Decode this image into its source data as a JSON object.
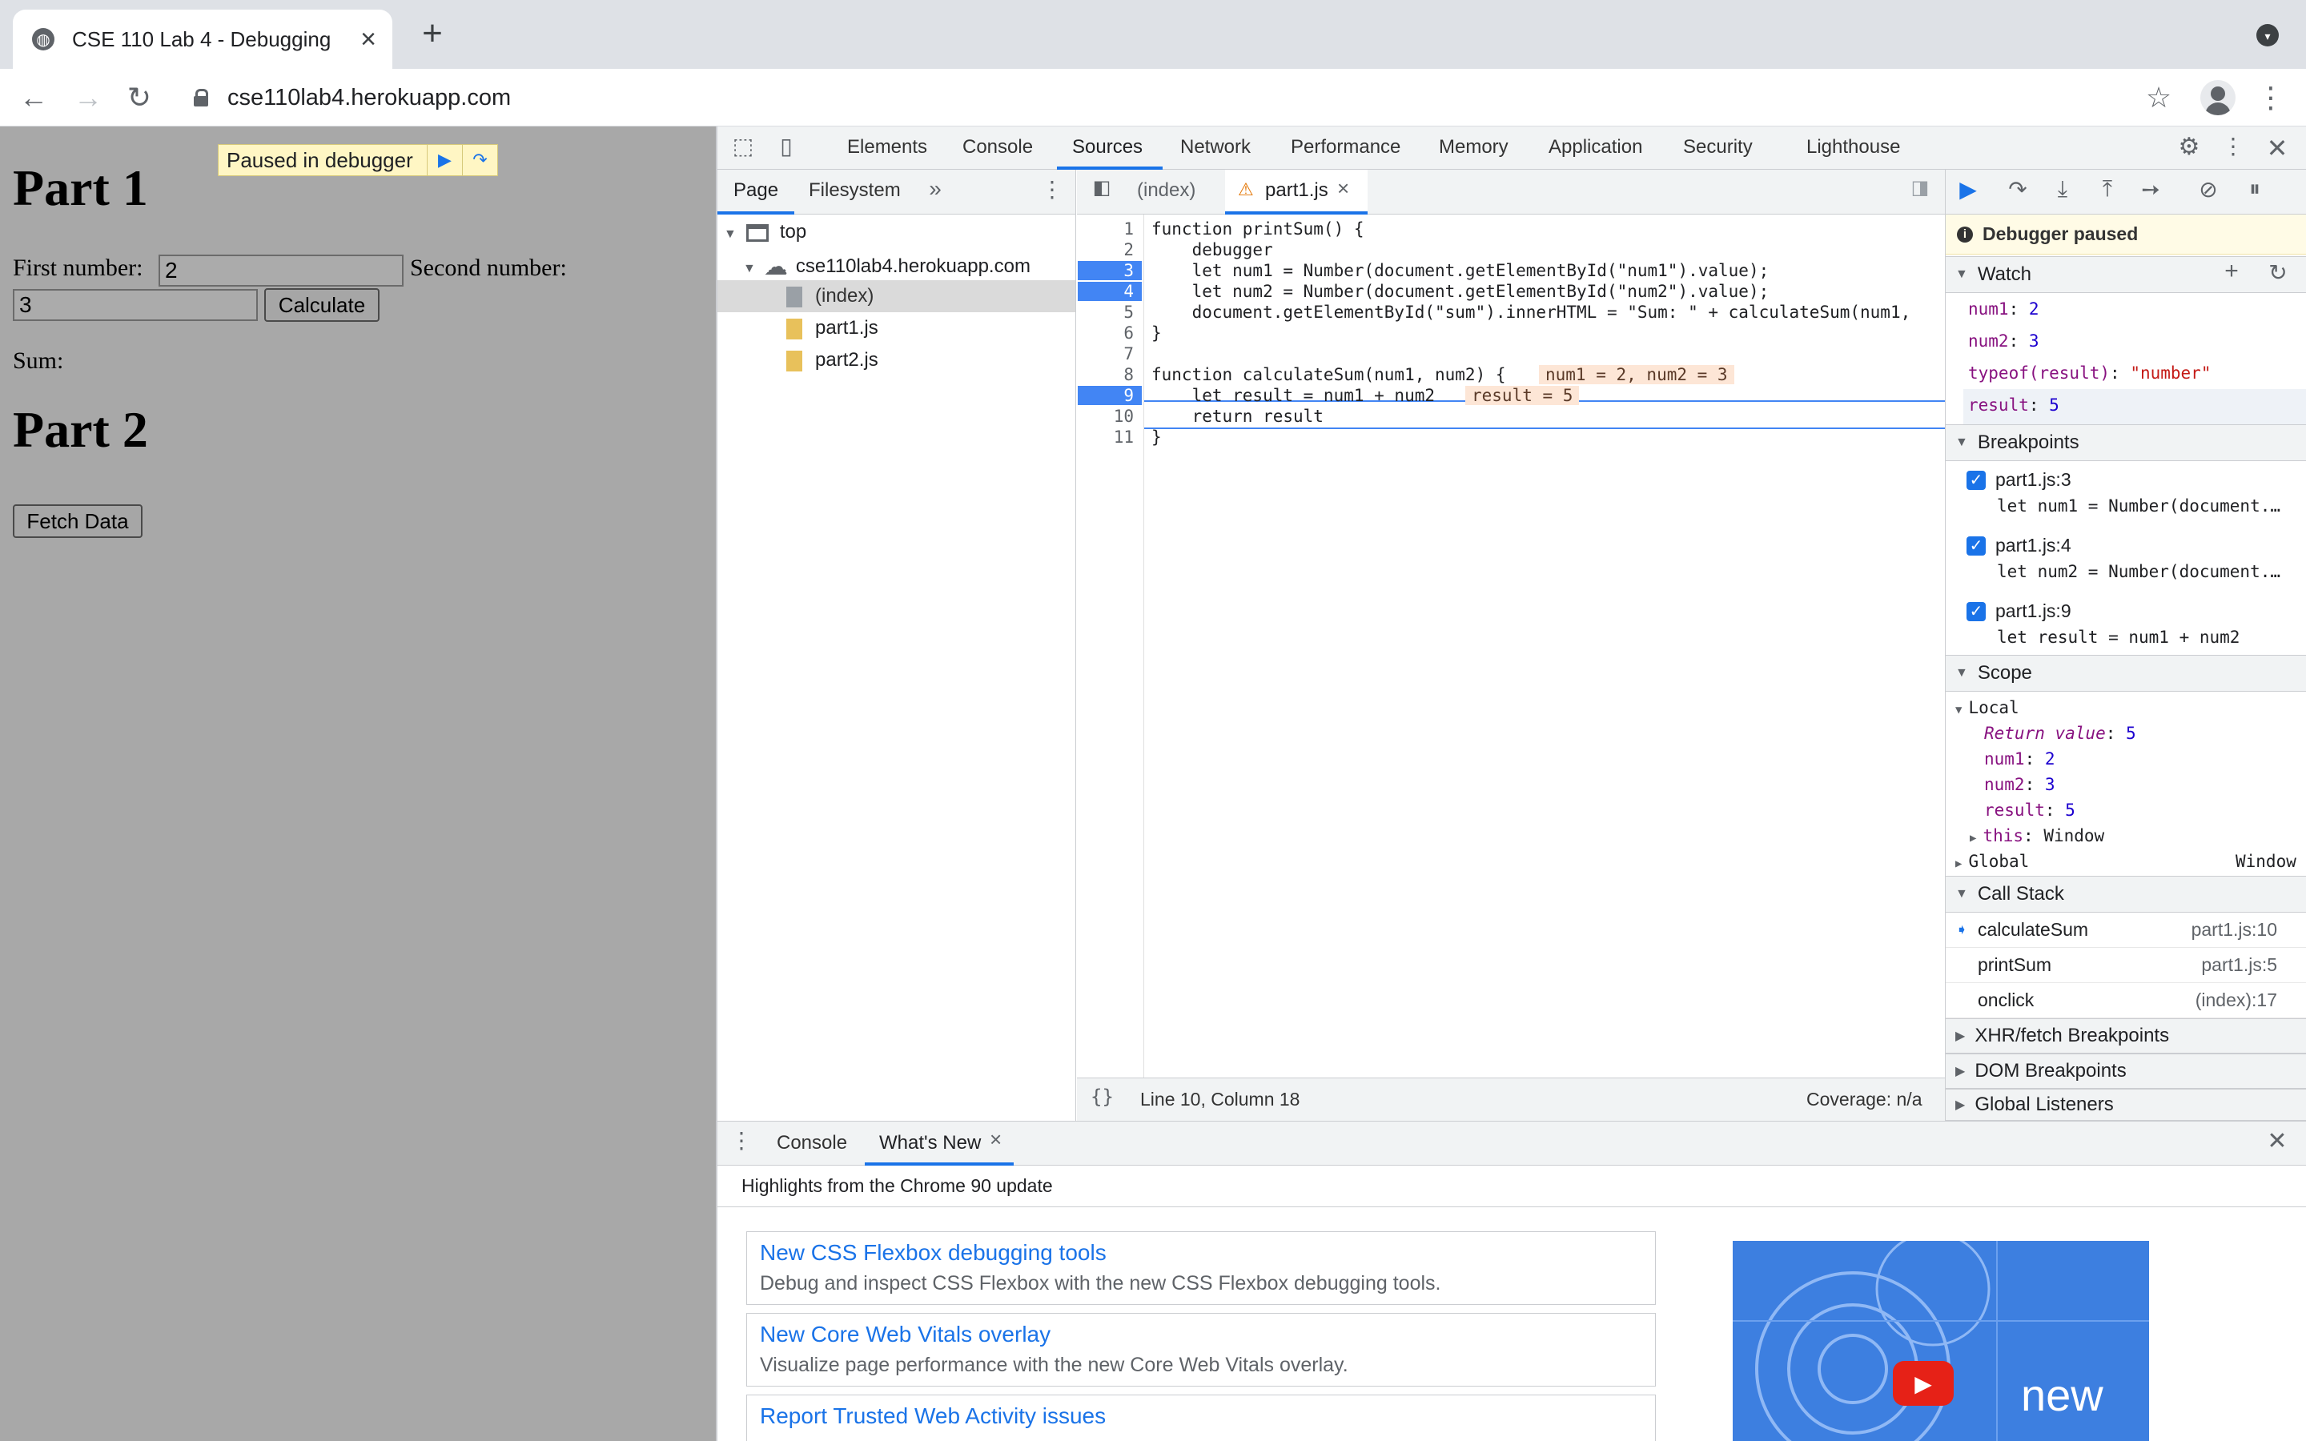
{
  "browser": {
    "tab_title": "CSE 110 Lab 4 - Debugging",
    "url": "cse110lab4.herokuapp.com"
  },
  "page": {
    "part1_heading": "Part 1",
    "first_number_label": "First number:",
    "first_number_value": "2",
    "second_number_label": "Second number:",
    "second_number_value": "3",
    "calculate_label": "Calculate",
    "sum_label": "Sum:",
    "part2_heading": "Part 2",
    "fetch_label": "Fetch Data",
    "paused_text": "Paused in debugger"
  },
  "devtools": {
    "tabs": [
      "Elements",
      "Console",
      "Sources",
      "Network",
      "Performance",
      "Memory",
      "Application",
      "Security",
      "Lighthouse"
    ],
    "active_tab": "Sources",
    "navigator_tabs": [
      "Page",
      "Filesystem"
    ],
    "tree": {
      "top": "top",
      "domain": "cse110lab4.herokuapp.com",
      "files": [
        "(index)",
        "part1.js",
        "part2.js"
      ]
    },
    "editor_tabs": [
      "(index)",
      "part1.js"
    ],
    "code_lines": [
      "function printSum() {",
      "    debugger",
      "    let num1 = Number(document.getElementById(\"num1\").value);",
      "    let num2 = Number(document.getElementById(\"num2\").value);",
      "    document.getElementById(\"sum\").innerHTML = \"Sum: \" + calculateSum(num1,",
      "}",
      "",
      "function calculateSum(num1, num2) {",
      "    let result = num1 + num2",
      "    return result",
      "}"
    ],
    "line_numbers": [
      "1",
      "2",
      "3",
      "4",
      "5",
      "6",
      "7",
      "8",
      "9",
      "10",
      "11"
    ],
    "inline_values": {
      "line8": "num1 = 2, num2 = 3",
      "line9": "result = 5"
    },
    "status": {
      "position": "Line 10, Column 18",
      "coverage": "Coverage: n/a"
    },
    "debugger_paused": "Debugger paused",
    "watch": {
      "title": "Watch",
      "items": [
        {
          "name": "num1",
          "value": "2"
        },
        {
          "name": "num2",
          "value": "3"
        },
        {
          "name": "typeof(result)",
          "value": "\"number\""
        },
        {
          "name": "result",
          "value": "5"
        }
      ]
    },
    "breakpoints": {
      "title": "Breakpoints",
      "items": [
        {
          "loc": "part1.js:3",
          "code": "let num1 = Number(document.…"
        },
        {
          "loc": "part1.js:4",
          "code": "let num2 = Number(document.…"
        },
        {
          "loc": "part1.js:9",
          "code": "let result = num1 + num2"
        }
      ]
    },
    "scope": {
      "title": "Scope",
      "local": "Local",
      "return_value": "Return value",
      "return_value_val": "5",
      "vars": [
        {
          "name": "num1",
          "value": "2"
        },
        {
          "name": "num2",
          "value": "3"
        },
        {
          "name": "result",
          "value": "5"
        }
      ],
      "this_name": "this",
      "this_val": "Window",
      "global": "Global",
      "global_val": "Window"
    },
    "call_stack": {
      "title": "Call Stack",
      "frames": [
        {
          "fn": "calculateSum",
          "loc": "part1.js:10"
        },
        {
          "fn": "printSum",
          "loc": "part1.js:5"
        },
        {
          "fn": "onclick",
          "loc": "(index):17"
        }
      ]
    },
    "more_sections": [
      "XHR/fetch Breakpoints",
      "DOM Breakpoints",
      "Global Listeners"
    ],
    "drawer": {
      "tabs": [
        "Console",
        "What's New"
      ],
      "highlight": "Highlights from the Chrome 90 update",
      "items": [
        {
          "title": "New CSS Flexbox debugging tools",
          "desc": "Debug and inspect CSS Flexbox with the new CSS Flexbox debugging tools."
        },
        {
          "title": "New Core Web Vitals overlay",
          "desc": "Visualize page performance with the new Core Web Vitals overlay."
        },
        {
          "title": "Report Trusted Web Activity issues",
          "desc": ""
        }
      ],
      "video_text": "new"
    }
  },
  "colors": {
    "accent": "#1a73e8",
    "page_bg": "#a8a8a8",
    "breakpoint": "#4285f4",
    "paused_bg": "#fffbe6"
  }
}
